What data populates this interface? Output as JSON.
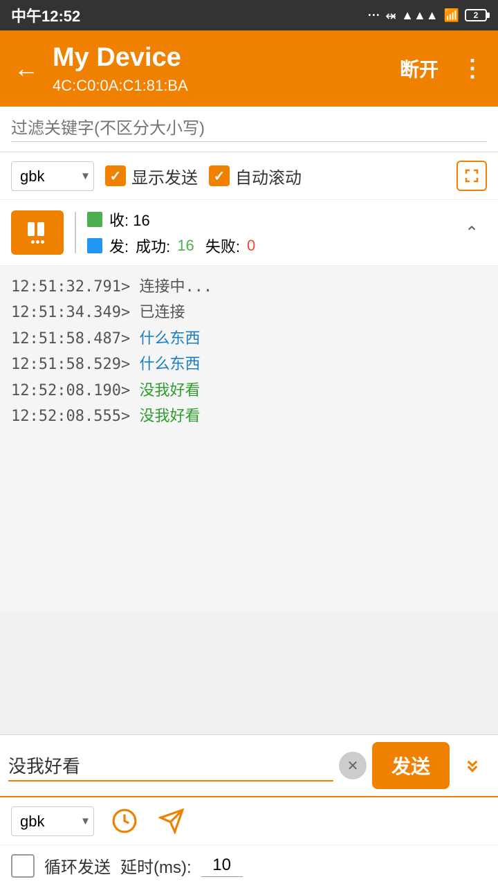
{
  "statusBar": {
    "time": "中午12:52",
    "battery": "2"
  },
  "header": {
    "deviceName": "My Device",
    "macAddress": "4C:C0:0A:C1:81:BA",
    "disconnectLabel": "断开",
    "backArrow": "←",
    "moreIcon": "⋮"
  },
  "filter": {
    "placeholder": "过滤关键字(不区分大小写)"
  },
  "controls": {
    "encoding": "gbk",
    "showSendLabel": "显示发送",
    "autoScrollLabel": "自动滚动"
  },
  "stats": {
    "recvLabel": "收: 16",
    "sendLabel": "发: 成功: 16 失败: 0",
    "successCount": "16",
    "failCount": "0"
  },
  "logs": [
    {
      "time": "12:51:32.791>",
      "message": "连接中...",
      "color": "gray"
    },
    {
      "time": "12:51:34.349>",
      "message": "已连接",
      "color": "gray"
    },
    {
      "time": "12:51:58.487>",
      "message": "什么东西",
      "color": "blue"
    },
    {
      "time": "12:51:58.529>",
      "message": "什么东西",
      "color": "blue"
    },
    {
      "time": "12:52:08.190>",
      "message": "没我好看",
      "color": "green"
    },
    {
      "time": "12:52:08.555>",
      "message": "没我好看",
      "color": "green"
    }
  ],
  "sendArea": {
    "inputValue": "没我好看",
    "sendLabel": "发送",
    "clearBtn": "×",
    "encoding": "gbk",
    "loopLabel": "循环发送",
    "delayLabel": "延时(ms):",
    "delayValue": "10",
    "scrollDownLabel": "≫"
  }
}
